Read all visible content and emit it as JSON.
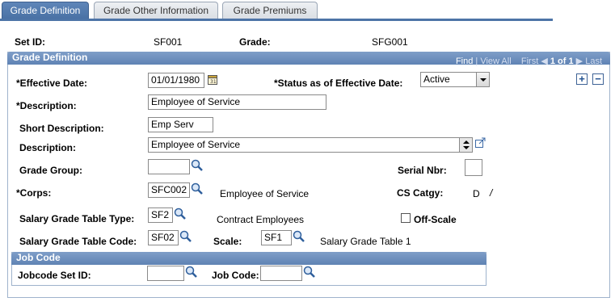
{
  "tabs": [
    {
      "label": "Grade Definition",
      "active": true
    },
    {
      "label": "Grade Other Information",
      "active": false
    },
    {
      "label": "Grade Premiums",
      "active": false
    }
  ],
  "header": {
    "setid_label": "Set ID:",
    "setid_value": "SF001",
    "grade_label": "Grade:",
    "grade_value": "SFG001"
  },
  "grade_definition": {
    "title": "Grade Definition",
    "nav": {
      "find": "Find",
      "view_all": "View All",
      "first": "First",
      "position": "1 of 1",
      "last": "Last"
    },
    "effective_date_label": "*Effective Date:",
    "effective_date_value": "01/01/1980",
    "status_label": "*Status as of Effective Date:",
    "status_value": "Active",
    "description_label": "*Description:",
    "description_value": "Employee of Service",
    "short_description_label": "Short Description:",
    "short_description_value": "Emp Serv",
    "long_description_label": "Description:",
    "long_description_value": "Employee of Service",
    "grade_group_label": "Grade Group:",
    "grade_group_value": "",
    "serial_nbr_label": "Serial Nbr:",
    "serial_nbr_value": "",
    "corps_label": "*Corps:",
    "corps_value": "SFC002",
    "corps_desc": "Employee of Service",
    "cs_catgy_label": "CS Catgy:",
    "cs_catgy_value": "D",
    "cs_catgy_sep": "/",
    "salary_grade_table_type_label": "Salary Grade Table Type:",
    "salary_grade_table_type_value": "SF2",
    "salary_grade_table_type_desc": "Contract Employees",
    "off_scale_label": "Off-Scale",
    "salary_grade_table_code_label": "Salary Grade Table Code:",
    "salary_grade_table_code_value": "SF02",
    "scale_label": "Scale:",
    "scale_value": "SF1",
    "scale_desc": "Salary Grade Table 1"
  },
  "job_code": {
    "title": "Job Code",
    "jobcode_setid_label": "Jobcode Set ID:",
    "jobcode_setid_value": "",
    "job_code_label": "Job Code:",
    "job_code_value": ""
  },
  "colors": {
    "tab_active": "#4d74a7",
    "group_header": "#6f91c0",
    "border": "#9fb3cc"
  }
}
